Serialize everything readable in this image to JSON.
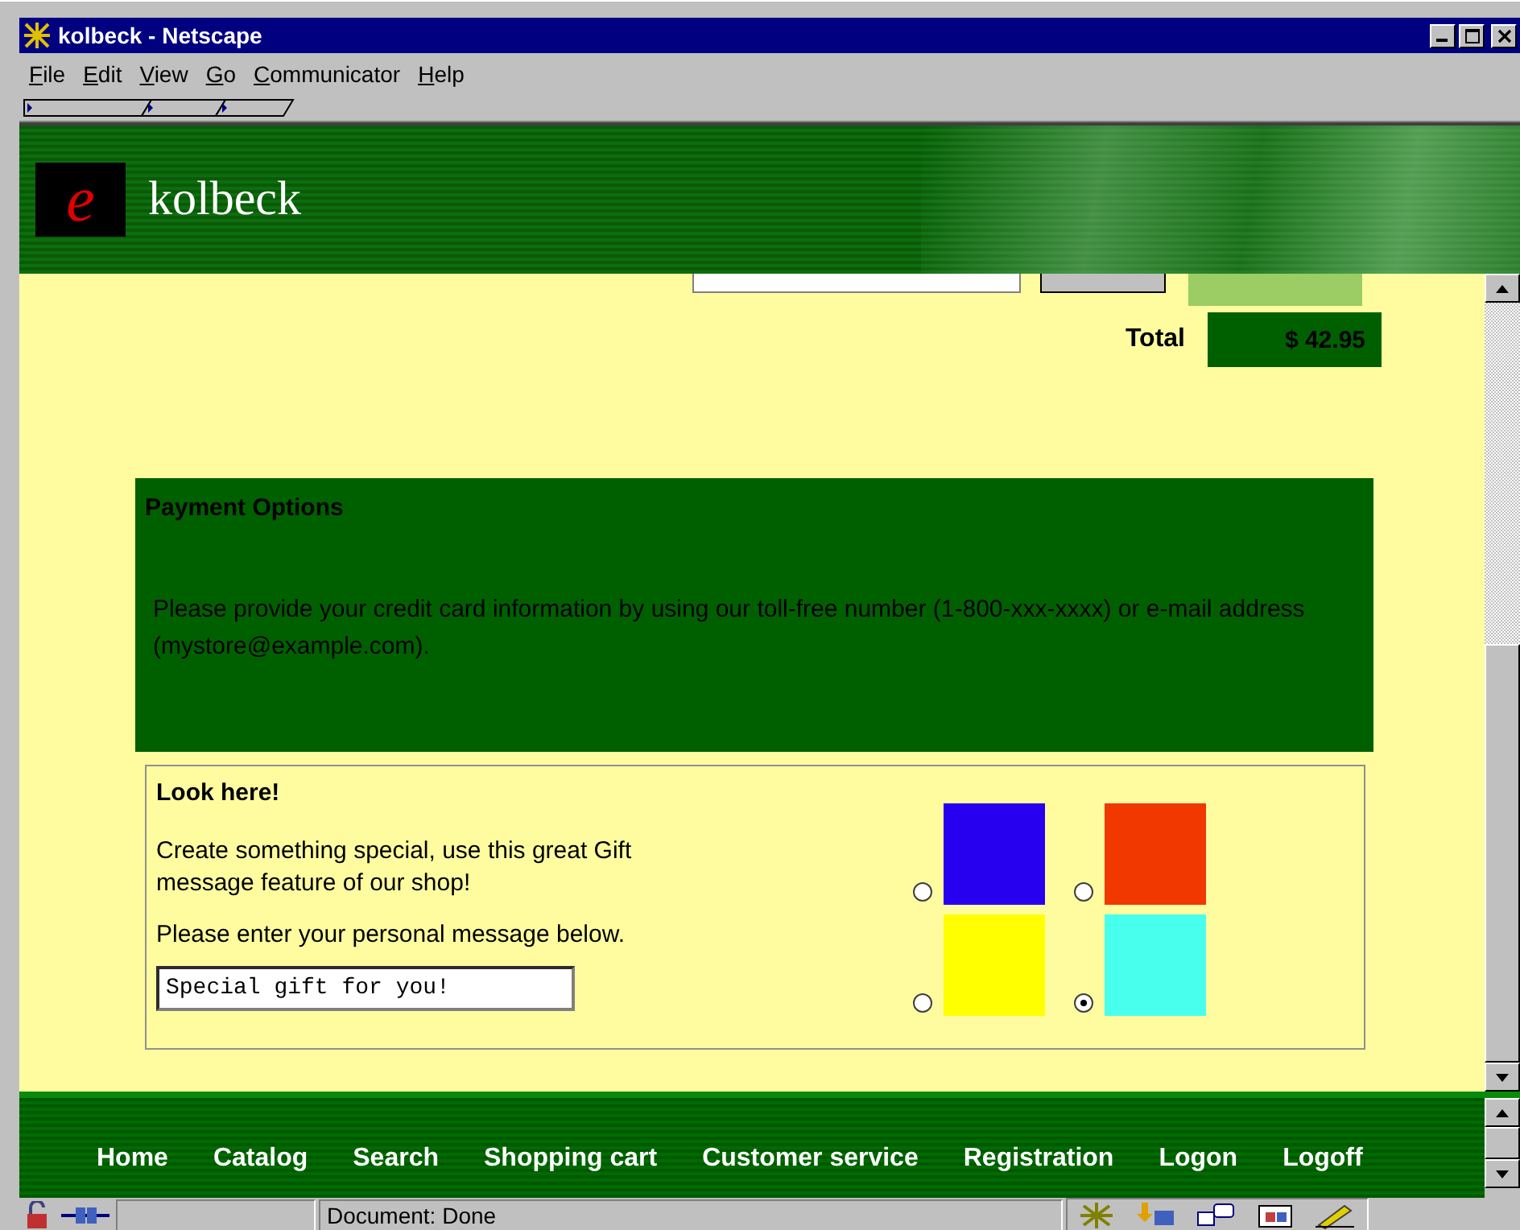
{
  "window": {
    "title": "kolbeck - Netscape"
  },
  "menu": [
    "File",
    "Edit",
    "View",
    "Go",
    "Communicator",
    "Help"
  ],
  "header": {
    "logo_mark": "e",
    "site_name": "kolbeck"
  },
  "order": {
    "total_label": "Total",
    "total_value": "$ 42.95"
  },
  "payment": {
    "title": "Payment Options",
    "text": "Please provide your credit card information by using our toll-free number (1-800-xxx-xxxx) or e-mail address (mystore@example.com)."
  },
  "gift": {
    "title": "Look here!",
    "intro": "Create something special, use this great Gift message feature of our shop!",
    "prompt": "Please enter your personal message below.",
    "message": "Special gift for you!",
    "options": [
      {
        "color": "#2800f0",
        "selected": false
      },
      {
        "color": "#f03800",
        "selected": false
      },
      {
        "color": "#ffff00",
        "selected": false
      },
      {
        "color": "#48ffee",
        "selected": true
      }
    ]
  },
  "nav": [
    "Home",
    "Catalog",
    "Search",
    "Shopping cart",
    "Customer service",
    "Registration",
    "Logon",
    "Logoff"
  ],
  "status_bar": {
    "text": "Document: Done"
  }
}
